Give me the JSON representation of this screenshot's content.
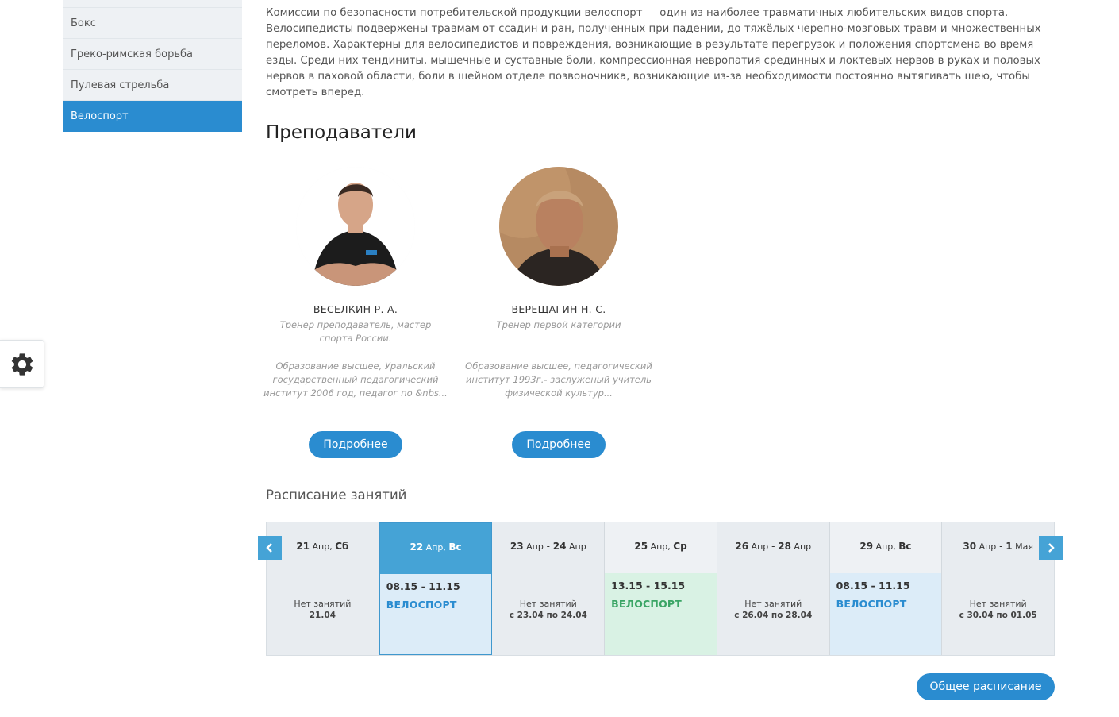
{
  "sidebar": {
    "items": [
      {
        "label": "Бокс"
      },
      {
        "label": "Греко-римская борьба"
      },
      {
        "label": "Пулевая стрельба"
      },
      {
        "label": "Велоспорт",
        "active": true
      }
    ]
  },
  "intro_text": "Комиссии по безопасности потребительской продукции велоспорт — один из наиболее травматичных любительских видов спорта. Велосипедисты подвержены травмам от ссадин и ран, полученных при падении, до тяжёлых черепно-мозговых травм и множественных переломов. Характерны для велосипедистов и повреждения, возникающие в результате перегрузок и положения спортсмена во время езды. Среди них тендиниты, мышечные и суставные боли, компрессионная невропатия срединных и локтевых нервов в руках и половых нервов в паховой области, боли в шейном отделе позвоночника, возникающие из-за необходимости постоянно вытягивать шею, чтобы смотреть вперед.",
  "teachers_title": "Преподаватели",
  "teachers": [
    {
      "name": "ВЕСЕЛКИН Р. А.",
      "role": "Тренер преподаватель, мастер спорта России.",
      "education": "Образование высшее, Уральский государственный педагогический институт 2006 год, педагог по &nbs...",
      "button": "Подробнее"
    },
    {
      "name": "ВЕРЕЩАГИН Н. С.",
      "role": "Тренер первой категории",
      "education": "Образование высшее, педагогический институт  1993г.- заслуженый учитель физической культур...",
      "button": "Подробнее"
    }
  ],
  "schedule_title": "Расписание занятий",
  "schedule": [
    {
      "d1": "21",
      "m1": " Апр, ",
      "w": "Сб",
      "d2": "",
      "m2": "",
      "sep": "",
      "empty": "Нет занятий",
      "range": "21.04"
    },
    {
      "d1": "22",
      "m1": " Апр, ",
      "w": "Вс",
      "d2": "",
      "m2": "",
      "sep": "",
      "time": "08.15 - 11.15",
      "sport": "ВЕЛОСПОРТ",
      "kind": "blue",
      "selected": true
    },
    {
      "d1": "23",
      "m1": " Апр",
      "w": "",
      "sep": " - ",
      "d2": "24",
      "m2": " Апр",
      "empty": "Нет занятий",
      "range": "с 23.04 по 24.04"
    },
    {
      "d1": "25",
      "m1": " Апр, ",
      "w": "Ср",
      "d2": "",
      "m2": "",
      "sep": "",
      "time": "13.15 - 15.15",
      "sport": "ВЕЛОСПОРТ",
      "kind": "green"
    },
    {
      "d1": "26",
      "m1": " Апр",
      "w": "",
      "sep": " - ",
      "d2": "28",
      "m2": " Апр",
      "empty": "Нет занятий",
      "range": "с 26.04 по 28.04"
    },
    {
      "d1": "29",
      "m1": " Апр, ",
      "w": "Вс",
      "d2": "",
      "m2": "",
      "sep": "",
      "time": "08.15 - 11.15",
      "sport": "ВЕЛОСПОРТ",
      "kind": "blue"
    },
    {
      "d1": "30",
      "m1": " Апр",
      "w": "",
      "sep": " - ",
      "d2": "1",
      "m2": " Мая",
      "empty": "Нет занятий",
      "range": "с 30.04 по 01.05"
    }
  ],
  "general_schedule_button": "Общее расписание",
  "colors": {
    "accent": "#2a8cd0",
    "selected_head": "#45a3d6",
    "green": "#3aa565"
  }
}
